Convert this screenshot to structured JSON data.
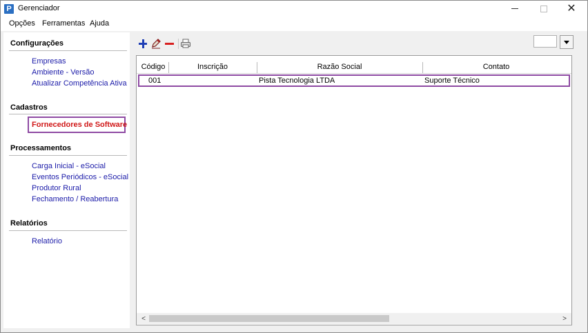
{
  "window": {
    "title": "Gerenciador",
    "icon_letter": "P",
    "close_symbol": "✕"
  },
  "menu": [
    {
      "label": "Opções"
    },
    {
      "label": "Ferramentas"
    },
    {
      "label": "Ajuda"
    }
  ],
  "sidebar": {
    "sections": [
      {
        "title": "Configurações",
        "items": [
          "Empresas",
          "Ambiente - Versão",
          "Atualizar Competência Ativa"
        ]
      },
      {
        "title": "Cadastros",
        "items": [
          "Fornecedores de Software"
        ]
      },
      {
        "title": "Processamentos",
        "items": [
          "Carga Inicial - eSocial",
          "Eventos Periódicos - eSocial",
          "Produtor Rural",
          "Fechamento / Reabertura"
        ]
      },
      {
        "title": "Relatórios",
        "items": [
          "Relatório"
        ]
      }
    ],
    "active_item": "Fornecedores de Software"
  },
  "toolbar": {
    "buttons": [
      {
        "name": "add-button",
        "icon": "plus-icon"
      },
      {
        "name": "edit-button",
        "icon": "pencil-icon"
      },
      {
        "name": "delete-button",
        "icon": "minus-icon"
      },
      {
        "name": "print-button",
        "icon": "printer-icon"
      }
    ],
    "combo_value": ""
  },
  "grid": {
    "columns": [
      "Código",
      "Inscrição",
      "Razão Social",
      "Contato"
    ],
    "rows": [
      {
        "codigo": "001",
        "inscricao": "",
        "razao_social": "Pista Tecnologia LTDA",
        "contato": "Suporte Técnico"
      }
    ],
    "scroll_left": "<",
    "scroll_right": ">"
  },
  "colors": {
    "accent_highlight": "#8e4aa3",
    "link": "#1a1aa8",
    "active_link": "#d01818"
  }
}
